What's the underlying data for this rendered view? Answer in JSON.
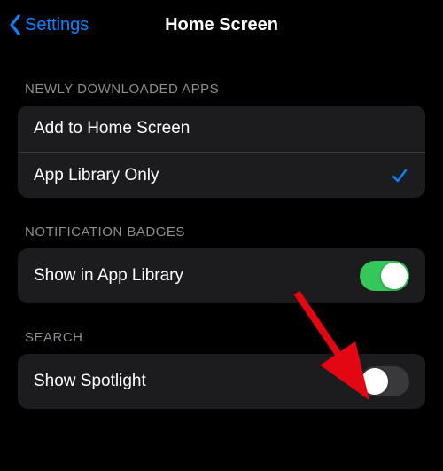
{
  "nav": {
    "back_label": "Settings",
    "title": "Home Screen"
  },
  "sections": {
    "newly_downloaded": {
      "header": "NEWLY DOWNLOADED APPS",
      "options": [
        {
          "label": "Add to Home Screen",
          "selected": false
        },
        {
          "label": "App Library Only",
          "selected": true
        }
      ]
    },
    "notification_badges": {
      "header": "NOTIFICATION BADGES",
      "toggle": {
        "label": "Show in App Library",
        "on": true
      }
    },
    "search": {
      "header": "SEARCH",
      "toggle": {
        "label": "Show Spotlight",
        "on": false
      }
    }
  },
  "colors": {
    "accent_blue": "#0a84ff",
    "toggle_green": "#34c759",
    "section_header": "#8e8e93",
    "cell_bg": "#1c1c1e",
    "arrow_red": "#e30613"
  }
}
